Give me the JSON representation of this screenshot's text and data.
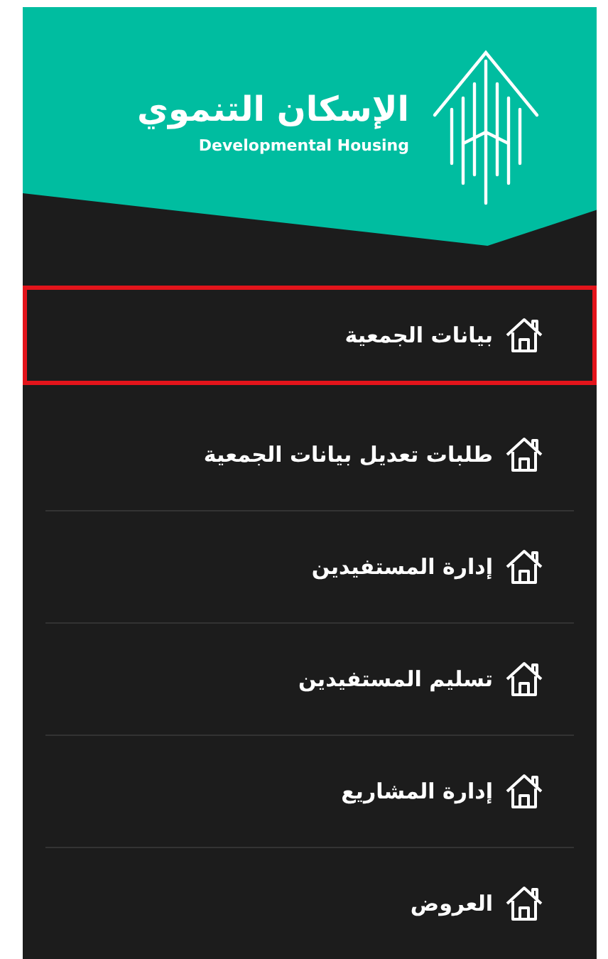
{
  "brand": {
    "title": "الإسكان التنموي",
    "subtitle": "Developmental Housing"
  },
  "menu": [
    {
      "label": "بيانات الجمعية",
      "selected": true
    },
    {
      "label": "طلبات تعديل بيانات الجمعية",
      "selected": false
    },
    {
      "label": "إدارة المستفيدين",
      "selected": false
    },
    {
      "label": "تسليم المستفيدين",
      "selected": false
    },
    {
      "label": "إدارة المشاريع",
      "selected": false
    },
    {
      "label": "العروض",
      "selected": false
    }
  ]
}
